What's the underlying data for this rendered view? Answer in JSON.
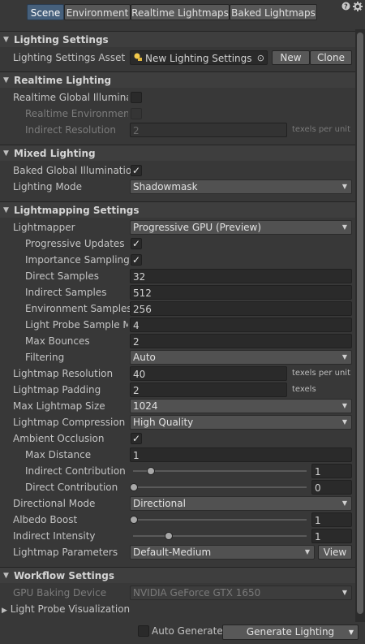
{
  "tabs": [
    "Scene",
    "Environment",
    "Realtime Lightmaps",
    "Baked Lightmaps"
  ],
  "window_icons": [
    "help-icon",
    "settings-icon"
  ],
  "sections": {
    "lighting_settings": {
      "title": "Lighting Settings",
      "asset_label": "Lighting Settings Asset",
      "asset_value": "New Lighting Settings",
      "new_button": "New",
      "clone_button": "Clone"
    },
    "realtime_lighting": {
      "title": "Realtime Lighting",
      "rgi_label": "Realtime Global Illuminatio",
      "env_label": "Realtime Environment L",
      "indirect_label": "Indirect Resolution",
      "indirect_value": "2",
      "indirect_unit": "texels per unit"
    },
    "mixed_lighting": {
      "title": "Mixed Lighting",
      "bgi_label": "Baked Global Illumination",
      "bgi_checked": true,
      "mode_label": "Lighting Mode",
      "mode_value": "Shadowmask"
    },
    "lightmapping": {
      "title": "Lightmapping Settings",
      "lightmapper_label": "Lightmapper",
      "lightmapper_value": "Progressive GPU (Preview)",
      "progressive_label": "Progressive Updates",
      "importance_label": "Importance Sampling",
      "direct_samples_label": "Direct Samples",
      "direct_samples_value": "32",
      "indirect_samples_label": "Indirect Samples",
      "indirect_samples_value": "512",
      "env_samples_label": "Environment Samples",
      "env_samples_value": "256",
      "probe_mult_label": "Light Probe Sample Mu",
      "probe_mult_value": "4",
      "max_bounces_label": "Max Bounces",
      "max_bounces_value": "2",
      "filtering_label": "Filtering",
      "filtering_value": "Auto",
      "resolution_label": "Lightmap Resolution",
      "resolution_value": "40",
      "resolution_unit": "texels per unit",
      "padding_label": "Lightmap Padding",
      "padding_value": "2",
      "padding_unit": "texels",
      "max_size_label": "Max Lightmap Size",
      "max_size_value": "1024",
      "compression_label": "Lightmap Compression",
      "compression_value": "High Quality",
      "ao_label": "Ambient Occlusion",
      "max_distance_label": "Max Distance",
      "max_distance_value": "1",
      "indirect_contrib_label": "Indirect Contribution",
      "indirect_contrib_value": "1",
      "indirect_contrib_level": 0.1,
      "direct_contrib_label": "Direct Contribution",
      "direct_contrib_value": "0",
      "direct_contrib_level": 0.0,
      "directional_label": "Directional Mode",
      "directional_value": "Directional",
      "albedo_label": "Albedo Boost",
      "albedo_value": "1",
      "albedo_level": 0.0,
      "intensity_label": "Indirect Intensity",
      "intensity_value": "1",
      "intensity_level": 0.2,
      "params_label": "Lightmap Parameters",
      "params_value": "Default-Medium",
      "view_button": "View"
    },
    "workflow": {
      "title": "Workflow Settings",
      "device_label": "GPU Baking Device",
      "device_value": "NVIDIA GeForce GTX 1650",
      "probe_vis_label": "Light Probe Visualization"
    }
  },
  "footer": {
    "auto_generate_label": "Auto Generate",
    "generate_button": "Generate Lighting"
  },
  "colors": {
    "background": "#383838",
    "active_tab": "#46607c",
    "field": "#2a2a2a"
  }
}
